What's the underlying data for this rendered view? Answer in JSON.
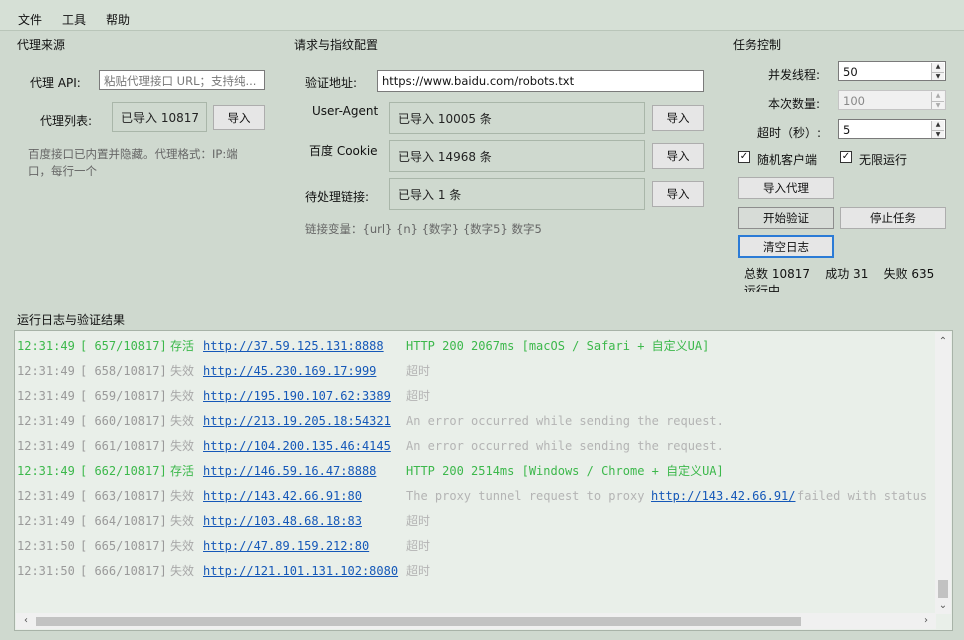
{
  "menu": {
    "file": "文件",
    "tools": "工具",
    "help": "帮助"
  },
  "proxy_source": {
    "title": "代理来源",
    "api_label": "代理 API:",
    "api_placeholder": "粘贴代理接口 URL；支持纯...",
    "list_label": "代理列表:",
    "list_value": "已导入 10817",
    "import_label": "导入",
    "hint_line1": "百度接口已内置并隐藏。代理格式：IP:端",
    "hint_line2": "口，每行一个"
  },
  "request_config": {
    "title": "请求与指纹配置",
    "url_label": "验证地址:",
    "url_value": "https://www.baidu.com/robots.txt",
    "ua_label": "User-Agent",
    "ua_value": "已导入 10005 条",
    "cookie_label": "百度 Cookie",
    "cookie_value": "已导入 14968 条",
    "links_label": "待处理链接:",
    "links_value": "已导入 1 条",
    "import_label": "导入",
    "vars_hint": "链接变量：{url} {n} {数字} {数字5} 数字5"
  },
  "task_control": {
    "title": "任务控制",
    "threads_label": "并发线程:",
    "threads_value": "50",
    "count_label": "本次数量:",
    "count_value": "100",
    "timeout_label": "超时（秒）:",
    "timeout_value": "5",
    "random_client_label": "随机客户端",
    "random_client_checked": true,
    "infinite_label": "无限运行",
    "infinite_checked": true,
    "import_proxy_label": "导入代理",
    "start_label": "开始验证",
    "stop_label": "停止任务",
    "clear_log_label": "清空日志",
    "stats_text": "总数 10817    成功 31    失败 635",
    "status_text": "运行中"
  },
  "log": {
    "title": "运行日志与验证结果",
    "rows": [
      {
        "time": "12:31:49",
        "idx": "[ 657/10817]",
        "status": "存活",
        "ok": true,
        "url": "http://37.59.125.131:8888",
        "msg": "HTTP 200 2067ms [macOS / Safari + 自定义UA]"
      },
      {
        "time": "12:31:49",
        "idx": "[ 658/10817]",
        "status": "失效",
        "ok": false,
        "url": "http://45.230.169.17:999",
        "msg": "超时"
      },
      {
        "time": "12:31:49",
        "idx": "[ 659/10817]",
        "status": "失效",
        "ok": false,
        "url": "http://195.190.107.62:3389",
        "msg": "超时"
      },
      {
        "time": "12:31:49",
        "idx": "[ 660/10817]",
        "status": "失效",
        "ok": false,
        "url": "http://213.19.205.18:54321",
        "msg": "An error occurred while sending the request."
      },
      {
        "time": "12:31:49",
        "idx": "[ 661/10817]",
        "status": "失效",
        "ok": false,
        "url": "http://104.200.135.46:4145",
        "msg": "An error occurred while sending the request."
      },
      {
        "time": "12:31:49",
        "idx": "[ 662/10817]",
        "status": "存活",
        "ok": true,
        "url": "http://146.59.16.47:8888",
        "msg": "HTTP 200 2514ms [Windows / Chrome + 自定义UA]"
      },
      {
        "time": "12:31:49",
        "idx": "[ 663/10817]",
        "status": "失效",
        "ok": false,
        "url": "http://143.42.66.91:80",
        "msg": "The proxy tunnel request to proxy ",
        "msg_link": "http://143.42.66.91/",
        "msg_tail": " failed with status"
      },
      {
        "time": "12:31:49",
        "idx": "[ 664/10817]",
        "status": "失效",
        "ok": false,
        "url": "http://103.48.68.18:83",
        "msg": "超时"
      },
      {
        "time": "12:31:50",
        "idx": "[ 665/10817]",
        "status": "失效",
        "ok": false,
        "url": "http://47.89.159.212:80",
        "msg": "超时"
      },
      {
        "time": "12:31:50",
        "idx": "[ 666/10817]",
        "status": "失效",
        "ok": false,
        "url": "http://121.101.131.102:8080",
        "msg": "超时"
      }
    ]
  },
  "icons": {
    "scroll_up": "chevron-up-icon",
    "scroll_down": "chevron-down-icon",
    "scroll_left": "chevron-left-icon",
    "scroll_right": "chevron-right-icon",
    "check": "check-icon"
  },
  "colors": {
    "background": "#cfd9cf",
    "success": "#3cb84b",
    "fail": "#9a9a9a",
    "link": "#1558b8",
    "focus": "#2b7bd6"
  }
}
